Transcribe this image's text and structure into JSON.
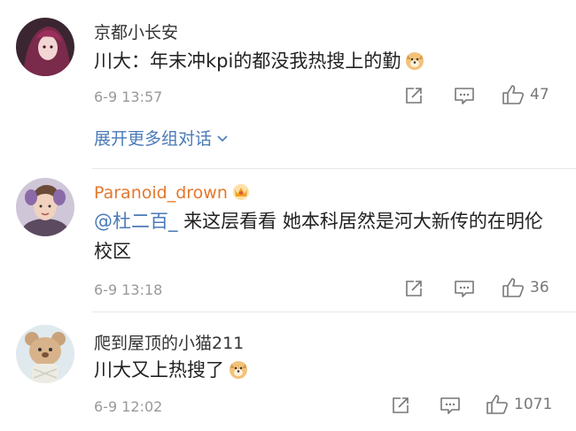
{
  "comments": [
    {
      "username": "京都小长安",
      "content_text": "川大：年末冲kpi的都没我热搜上的勤",
      "emoji": "doge-emoji",
      "time": "6-9 13:57",
      "likes": "47",
      "expand_label": "展开更多组对话"
    },
    {
      "username": "Paranoid_drown",
      "mention": "@杜二百_",
      "content_text": " 来这层看看 她本科居然是河大新传的在明伦校区",
      "time": "6-9 13:18",
      "likes": "36"
    },
    {
      "username": "爬到屋顶的小猫211",
      "content_text": "川大又上热搜了",
      "emoji": "doge-emoji",
      "time": "6-9 12:02",
      "likes": "1071"
    }
  ],
  "colors": {
    "mention": "#4a7ab8",
    "vip_name": "#e4782c",
    "meta": "#999999"
  },
  "icons": [
    "share-icon",
    "comment-icon",
    "like-icon",
    "chevron-down-icon",
    "vip-crown-icon"
  ]
}
